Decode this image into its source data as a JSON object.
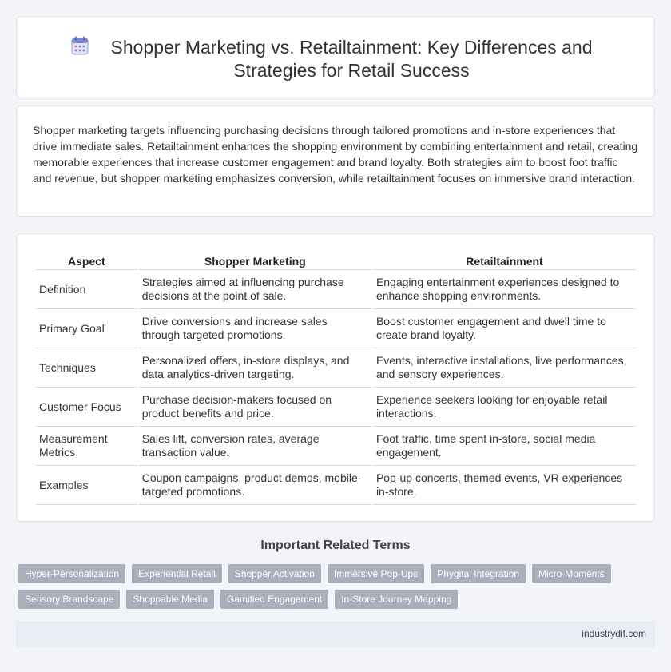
{
  "header": {
    "icon": "calendar-icon",
    "title": "Shopper Marketing vs. Retailtainment: Key Differences and Strategies for Retail Success"
  },
  "intro": {
    "text": "Shopper marketing targets influencing purchasing decisions through tailored promotions and in-store experiences that drive immediate sales. Retailtainment enhances the shopping environment by combining entertainment and retail, creating memorable experiences that increase customer engagement and brand loyalty. Both strategies aim to boost foot traffic and revenue, but shopper marketing emphasizes conversion, while retailtainment focuses on immersive brand interaction."
  },
  "table": {
    "headers": [
      "Aspect",
      "Shopper Marketing",
      "Retailtainment"
    ],
    "rows": [
      [
        "Definition",
        "Strategies aimed at influencing purchase decisions at the point of sale.",
        "Engaging entertainment experiences designed to enhance shopping environments."
      ],
      [
        "Primary Goal",
        "Drive conversions and increase sales through targeted promotions.",
        "Boost customer engagement and dwell time to create brand loyalty."
      ],
      [
        "Techniques",
        "Personalized offers, in-store displays, and data analytics-driven targeting.",
        "Events, interactive installations, live performances, and sensory experiences."
      ],
      [
        "Customer Focus",
        "Purchase decision-makers focused on product benefits and price.",
        "Experience seekers looking for enjoyable retail interactions."
      ],
      [
        "Measurement Metrics",
        "Sales lift, conversion rates, average transaction value.",
        "Foot traffic, time spent in-store, social media engagement."
      ],
      [
        "Examples",
        "Coupon campaigns, product demos, mobile-targeted promotions.",
        "Pop-up concerts, themed events, VR experiences in-store."
      ]
    ]
  },
  "related": {
    "title": "Important Related Terms",
    "tags_row1": [
      "Hyper-Personalization",
      "Experiential Retail",
      "Shopper Activation",
      "Immersive Pop-Ups",
      "Phygital Integration",
      "Micro-Moments"
    ],
    "tags_row2": [
      "Sensory Brandscape",
      "Shoppable Media",
      "Gamified Engagement",
      "In-Store Journey Mapping"
    ]
  },
  "footer": {
    "site": "industrydif.com"
  }
}
